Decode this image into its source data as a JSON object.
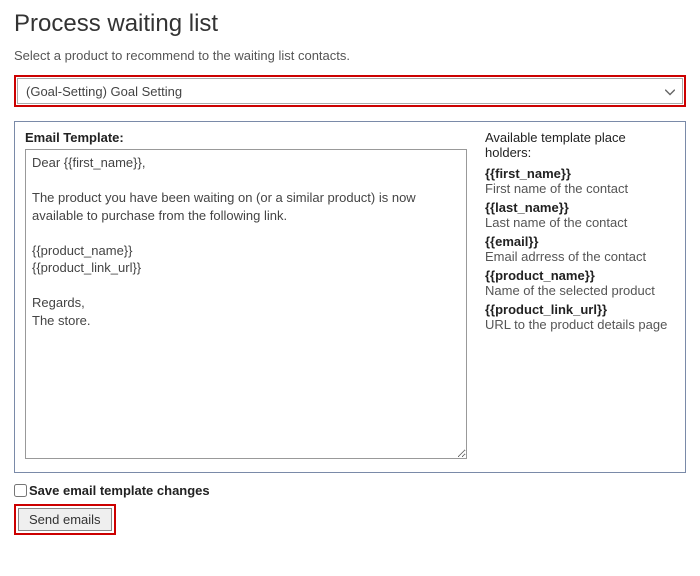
{
  "page": {
    "title": "Process waiting list",
    "subtitle": "Select a product to recommend to the waiting list contacts."
  },
  "product_select": {
    "selected": "(Goal-Setting) Goal Setting"
  },
  "email_template": {
    "label": "Email Template:",
    "body": "Dear {{first_name}},\n\nThe product you have been waiting on (or a similar product) is now available to purchase from the following link.\n\n{{product_name}}\n{{product_link_url}}\n\nRegards,\nThe store."
  },
  "placeholders": {
    "heading": "Available template place holders:",
    "items": [
      {
        "token": "{{first_name}}",
        "desc": "First name of the contact"
      },
      {
        "token": "{{last_name}}",
        "desc": "Last name of the contact"
      },
      {
        "token": "{{email}}",
        "desc": "Email adrress of the contact"
      },
      {
        "token": "{{product_name}}",
        "desc": "Name of the selected product"
      },
      {
        "token": "{{product_link_url}}",
        "desc": "URL to the product details page"
      }
    ]
  },
  "save_checkbox": {
    "label": "Save email template changes",
    "checked": false
  },
  "send_button": {
    "label": "Send emails"
  }
}
